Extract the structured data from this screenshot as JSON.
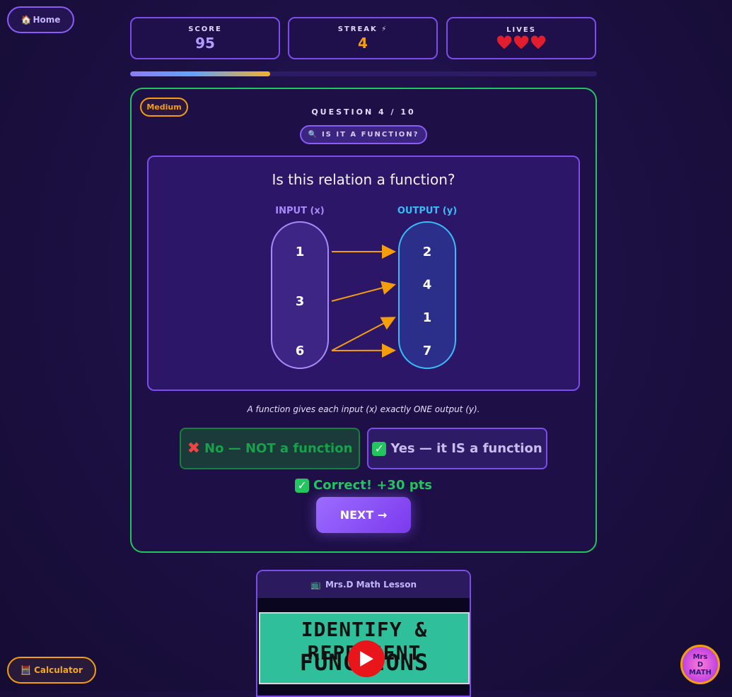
{
  "nav": {
    "home_label": "Home",
    "home_icon": "house-icon"
  },
  "stats": {
    "score_label": "SCORE",
    "score_value": "95",
    "streak_label": "STREAK ⚡",
    "streak_value": "4",
    "lives_label": "LIVES",
    "lives": 3
  },
  "progress": {
    "fraction": 0.3
  },
  "question": {
    "difficulty": "Medium",
    "number_text": "QUESTION 4 / 10",
    "topic": "IS IT A FUNCTION?",
    "prompt": "Is this relation a function?",
    "input_label": "INPUT (x)",
    "output_label": "OUTPUT (y)",
    "inputs": [
      "1",
      "3",
      "6"
    ],
    "outputs": [
      "2",
      "4",
      "1",
      "7"
    ],
    "mappings": [
      [
        0,
        0
      ],
      [
        1,
        1
      ],
      [
        2,
        2
      ],
      [
        2,
        3
      ]
    ],
    "hint": "A function gives each input (x) exactly ONE output (y).",
    "answer_no": "No — NOT a function",
    "answer_yes": "Yes — it IS a function",
    "feedback": "Correct! +30 pts",
    "next_label": "NEXT →"
  },
  "video": {
    "header": "Mrs.D Math Lesson",
    "thumb_line1": "IDENTIFY & REPRESENT",
    "thumb_line2": "FUNCTIONS"
  },
  "tools": {
    "calculator_label": "Calculator"
  },
  "logo": {
    "line1": "Mrs",
    "line2": "D",
    "line3": "MATH"
  },
  "colors": {
    "accent": "#8b5cf6",
    "success": "#22c55e",
    "warning": "#f59e0b",
    "output": "#38bdf8"
  }
}
